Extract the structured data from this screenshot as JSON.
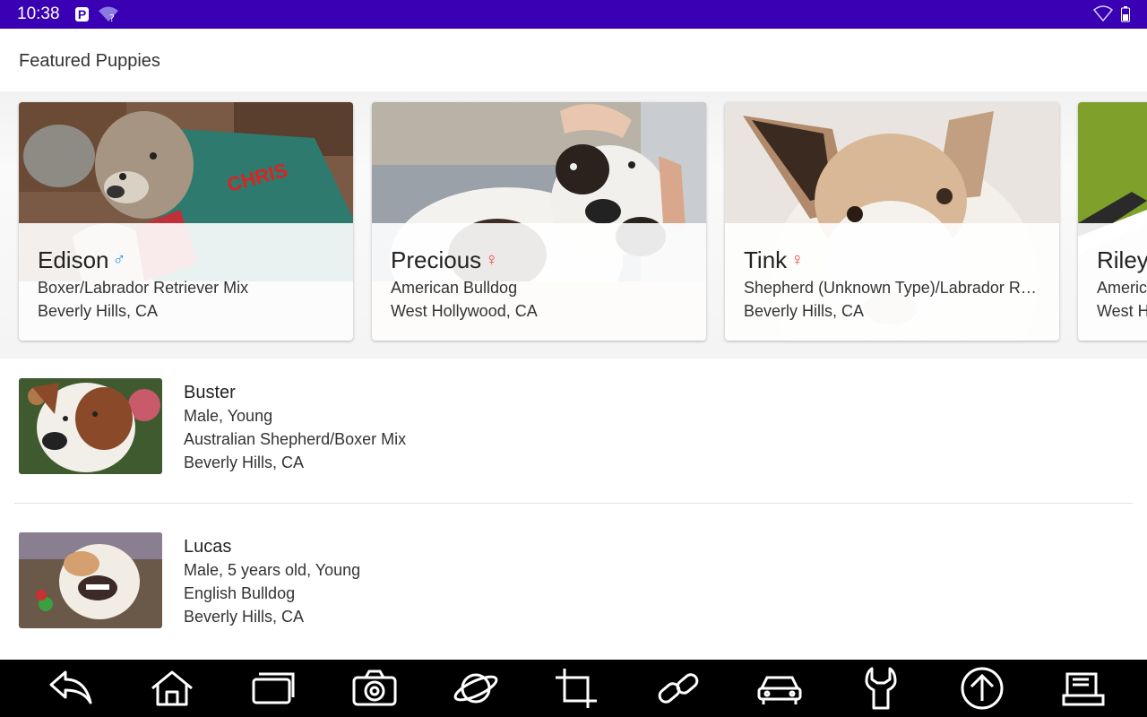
{
  "status_bar": {
    "time": "10:38",
    "app_badge": "P"
  },
  "header": {
    "title": "Featured Puppies"
  },
  "featured": [
    {
      "name": "Edison",
      "gender": "male",
      "gender_symbol": "♂",
      "breed": "Boxer/Labrador Retriever Mix",
      "location": "Beverly Hills, CA"
    },
    {
      "name": "Precious",
      "gender": "female",
      "gender_symbol": "♀",
      "breed": "American Bulldog",
      "location": "West Hollywood, CA"
    },
    {
      "name": "Tink",
      "gender": "female",
      "gender_symbol": "♀",
      "breed": "Shepherd (Unknown Type)/Labrador Re...",
      "location": "Beverly Hills, CA"
    },
    {
      "name": "Riley",
      "breed": "Americ",
      "location": "West H"
    }
  ],
  "list": [
    {
      "name": "Buster",
      "details": "Male, Young",
      "breed": "Australian Shepherd/Boxer Mix",
      "location": "Beverly Hills, CA"
    },
    {
      "name": "Lucas",
      "details": "Male, 5 years old, Young",
      "breed": "English Bulldog",
      "location": "Beverly Hills, CA"
    }
  ],
  "nav_icons": [
    "back-icon",
    "home-icon",
    "recents-icon",
    "camera-icon",
    "planet-icon",
    "crop-icon",
    "link-icon",
    "car-icon",
    "wrench-icon",
    "upload-arrow-icon",
    "document-stack-icon"
  ],
  "colors": {
    "status_bar": "#3a00b4",
    "male": "#2196f3",
    "female": "#f44336",
    "nav_bar": "#000000"
  }
}
